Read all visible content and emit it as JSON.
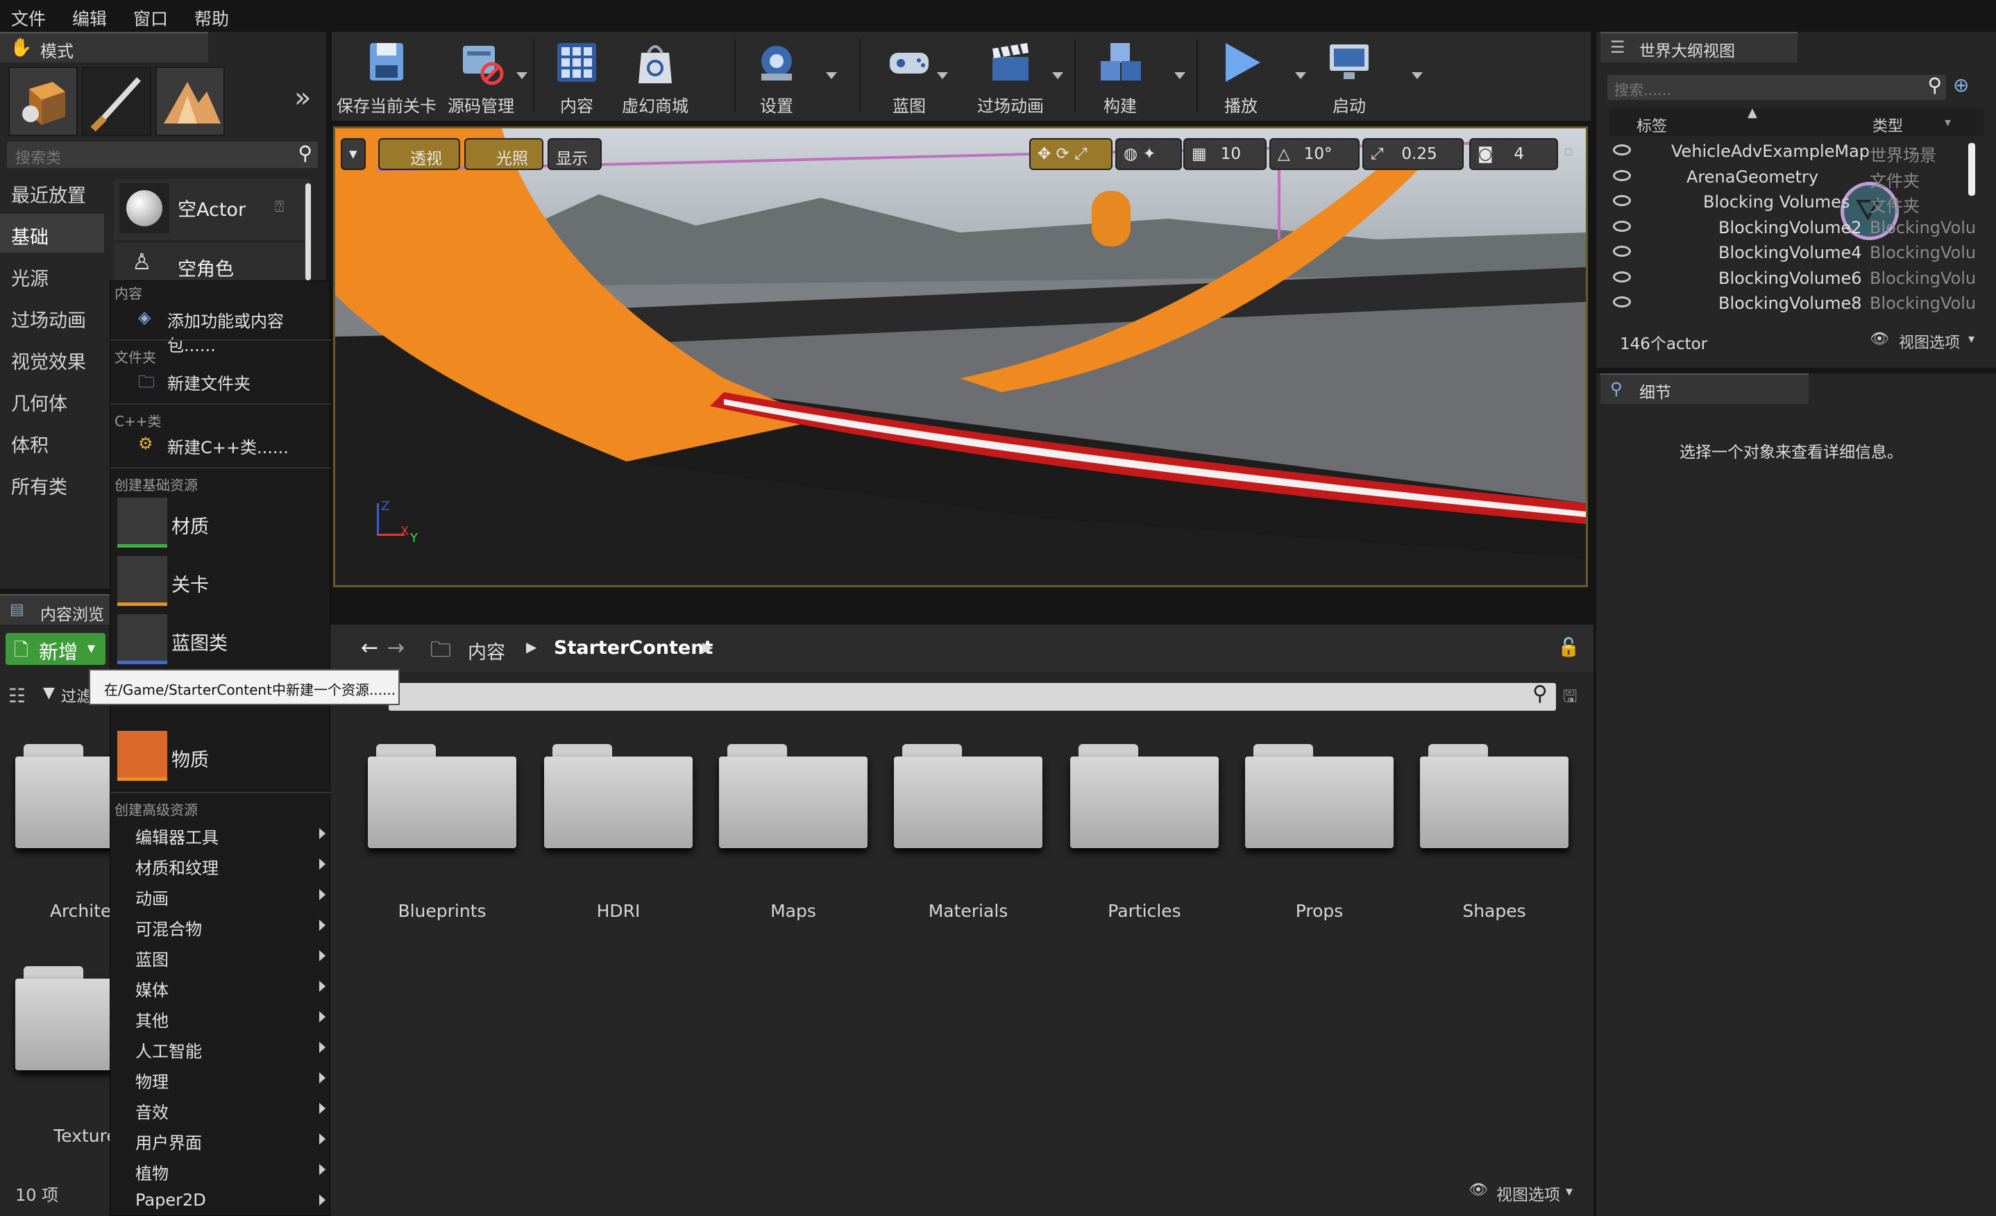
{
  "menubar": {
    "items": [
      "文件",
      "编辑",
      "窗口",
      "帮助"
    ]
  },
  "modes": {
    "tab_label": "模式",
    "search_placeholder": "搜索类",
    "categories": [
      "最近放置",
      "基础",
      "光源",
      "过场动画",
      "视觉效果",
      "几何体",
      "体积",
      "所有类"
    ],
    "selected_category": "基础",
    "items": [
      "空Actor",
      "空角色"
    ]
  },
  "toolbar": {
    "buttons": [
      "保存当前关卡",
      "源码管理",
      "内容",
      "虚幻商城",
      "设置",
      "蓝图",
      "过场动画",
      "构建",
      "播放",
      "启动"
    ]
  },
  "viewport": {
    "perspective": "透视",
    "lighting": "光照",
    "show": "显示",
    "grid_snap": "10",
    "rotation_snap": "10°",
    "scale_snap": "0.25",
    "camera_speed": "4",
    "axis_labels": [
      "Z",
      "X",
      "Y"
    ]
  },
  "content_browser": {
    "tab_label": "内容浏览",
    "add_new": "新增",
    "filter": "过滤",
    "path": [
      "内容",
      "StarterContent"
    ],
    "folders_left": [
      "Architec",
      "Texture"
    ],
    "folders": [
      "Blueprints",
      "HDRI",
      "Maps",
      "Materials",
      "Particles",
      "Props",
      "Shapes"
    ],
    "count": "10 项",
    "view_options": "视图选项"
  },
  "menu": {
    "sections": {
      "content": "内容",
      "folder": "文件夹",
      "cpp": "C++类",
      "basic": "创建基础资源",
      "advanced": "创建高级资源"
    },
    "add_feature": "添加功能或内容包......",
    "new_folder": "新建文件夹",
    "new_cpp": "新建C++类......",
    "basic_items": [
      "材质",
      "关卡",
      "蓝图类",
      "物质"
    ],
    "advanced_items": [
      "编辑器工具",
      "材质和纹理",
      "动画",
      "可混合物",
      "蓝图",
      "媒体",
      "其他",
      "人工智能",
      "物理",
      "音效",
      "用户界面",
      "植物",
      "Paper2D"
    ]
  },
  "tooltip": "在/Game/StarterContent中新建一个资源......",
  "outliner": {
    "tab_label": "世界大纲视图",
    "search_placeholder": "搜索......",
    "col_label": "标签",
    "col_type": "类型",
    "rows": [
      {
        "label": "VehicleAdvExampleMap",
        "type": "世界场景"
      },
      {
        "label": "ArenaGeometry",
        "type": "文件夹"
      },
      {
        "label": "Blocking Volumes",
        "type": "文件夹"
      },
      {
        "label": "BlockingVolume2",
        "type": "BlockingVolu"
      },
      {
        "label": "BlockingVolume4",
        "type": "BlockingVolu"
      },
      {
        "label": "BlockingVolume6",
        "type": "BlockingVolu"
      },
      {
        "label": "BlockingVolume8",
        "type": "BlockingVolu"
      }
    ],
    "actor_count": "146个actor",
    "view_options": "视图选项"
  },
  "details": {
    "tab_label": "细节",
    "empty_text": "选择一个对象来查看详细信息。"
  }
}
